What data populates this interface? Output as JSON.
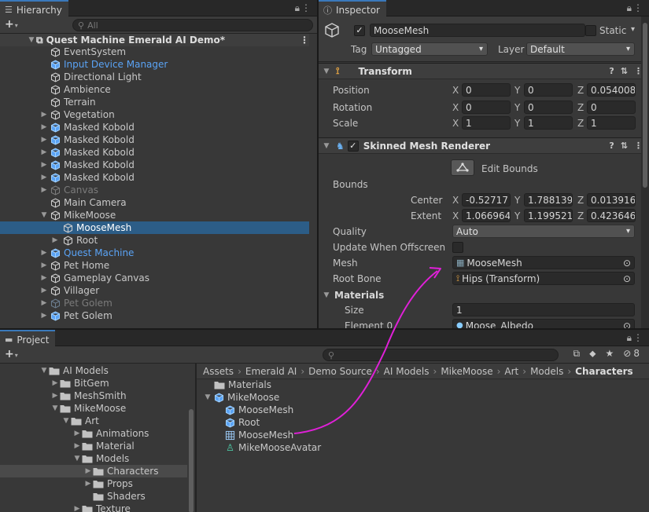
{
  "hierarchy": {
    "tab": "Hierarchy",
    "search_placeholder": "All",
    "scene": "Quest Machine Emerald AI Demo*",
    "items": [
      {
        "label": "EventSystem"
      },
      {
        "label": "Input Device Manager"
      },
      {
        "label": "Directional Light"
      },
      {
        "label": "Ambience"
      },
      {
        "label": "Terrain"
      },
      {
        "label": "Vegetation"
      },
      {
        "label": "Masked Kobold"
      },
      {
        "label": "Masked Kobold"
      },
      {
        "label": "Masked Kobold"
      },
      {
        "label": "Masked Kobold"
      },
      {
        "label": "Masked Kobold"
      },
      {
        "label": "Canvas"
      },
      {
        "label": "Main Camera"
      },
      {
        "label": "MikeMoose"
      },
      {
        "label": "MooseMesh"
      },
      {
        "label": "Root"
      },
      {
        "label": "Quest Machine"
      },
      {
        "label": "Pet Home"
      },
      {
        "label": "Gameplay Canvas"
      },
      {
        "label": "Villager"
      },
      {
        "label": "Pet Golem"
      },
      {
        "label": "Pet Golem"
      }
    ]
  },
  "inspector": {
    "tab": "Inspector",
    "object_name": "MooseMesh",
    "static_label": "Static",
    "tag_label": "Tag",
    "tag_value": "Untagged",
    "layer_label": "Layer",
    "layer_value": "Default",
    "transform": {
      "title": "Transform",
      "position_label": "Position",
      "rotation_label": "Rotation",
      "scale_label": "Scale",
      "position": [
        "0",
        "0",
        "0.054008"
      ],
      "rotation": [
        "0",
        "0",
        "0"
      ],
      "scale": [
        "1",
        "1",
        "1"
      ]
    },
    "smr": {
      "title": "Skinned Mesh Renderer",
      "edit_bounds": "Edit Bounds",
      "bounds_label": "Bounds",
      "center_label": "Center",
      "extent_label": "Extent",
      "center": [
        "-0.52717",
        "1.788139",
        "0.013916"
      ],
      "extent": [
        "1.066964",
        "1.199521",
        "0.423646"
      ],
      "quality_label": "Quality",
      "quality_value": "Auto",
      "update_offscreen_label": "Update When Offscreen",
      "mesh_label": "Mesh",
      "mesh_value": "MooseMesh",
      "root_bone_label": "Root Bone",
      "root_bone_value": "Hips (Transform)",
      "materials_label": "Materials",
      "size_label": "Size",
      "size_value": "1",
      "element0_label": "Element 0",
      "element0_value": "Moose_Albedo"
    },
    "axis": [
      "X",
      "Y",
      "Z"
    ]
  },
  "project": {
    "tab": "Project",
    "hidden_count": "8",
    "tree": [
      {
        "label": "AI Models"
      },
      {
        "label": "BitGem"
      },
      {
        "label": "MeshSmith"
      },
      {
        "label": "MikeMoose"
      },
      {
        "label": "Art"
      },
      {
        "label": "Animations"
      },
      {
        "label": "Material"
      },
      {
        "label": "Models"
      },
      {
        "label": "Characters"
      },
      {
        "label": "Props"
      },
      {
        "label": "Shaders"
      },
      {
        "label": "Texture"
      }
    ],
    "breadcrumb": [
      "Assets",
      "Emerald AI",
      "Demo Source",
      "AI Models",
      "MikeMoose",
      "Art",
      "Models",
      "Characters"
    ],
    "assets": [
      {
        "label": "Materials"
      },
      {
        "label": "MikeMoose"
      },
      {
        "label": "MooseMesh"
      },
      {
        "label": "Root"
      },
      {
        "label": "MooseMesh"
      },
      {
        "label": "MikeMooseAvatar"
      }
    ]
  },
  "colors": {
    "selection": "#2c5d87",
    "accent": "#3a79bb",
    "prefab_blue": "#5aa3f5",
    "arrow": "#e020d8"
  }
}
